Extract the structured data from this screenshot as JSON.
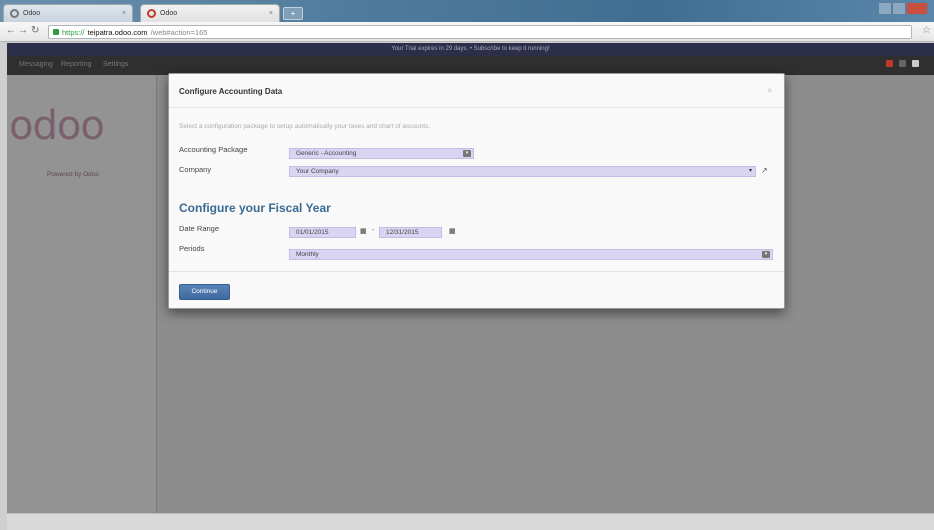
{
  "browser": {
    "tabs": [
      {
        "label": "Odoo"
      },
      {
        "label": "Odoo"
      }
    ],
    "url": {
      "scheme": "https://",
      "host": "teipatra.odoo.com",
      "path": "/web#action=165"
    }
  },
  "app": {
    "announcement": "Your Trial expires in 29 days. • Subscribe to keep it running!",
    "menu": [
      "Messaging",
      "Reporting",
      "Settings"
    ],
    "logo": "odoo",
    "powered_by": "Powered by Odoo"
  },
  "dialog": {
    "title": "Configure Accounting Data",
    "close": "×",
    "help": "Select a configuration package to setup automatically your taxes and chart of accounts.",
    "accounting_package": {
      "label": "Accounting Package",
      "value": "Generic - Accounting"
    },
    "company": {
      "label": "Company",
      "value": "Your Company"
    },
    "fiscal_title": "Configure your Fiscal Year",
    "date_range": {
      "label": "Date Range",
      "start": "01/01/2015",
      "end": "12/31/2015"
    },
    "periods": {
      "label": "Periods",
      "value": "Monthly"
    },
    "continue_label": "Continue"
  }
}
